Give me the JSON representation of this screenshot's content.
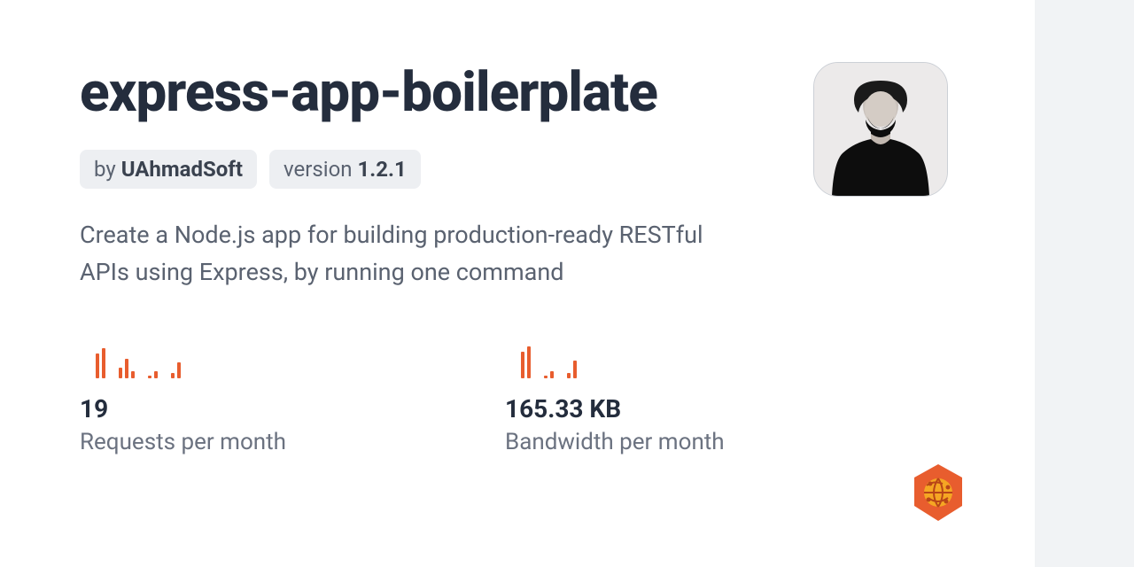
{
  "package": {
    "name": "express-app-boilerplate",
    "author_prefix": "by",
    "author": "UAhmadSoft",
    "version_prefix": "version",
    "version": "1.2.1",
    "description": "Create a Node.js app for building production-ready RESTful APIs using Express, by running one command"
  },
  "stats": {
    "requests": {
      "value": "19",
      "label": "Requests per month",
      "spark": [
        [
          28,
          34
        ],
        [
          12,
          22,
          8
        ],
        [
          3,
          8
        ],
        [
          6,
          18
        ]
      ]
    },
    "bandwidth": {
      "value": "165.33 KB",
      "label": "Bandwidth per month",
      "spark": [
        [
          30,
          36
        ],
        [
          3,
          8
        ],
        [
          6,
          20
        ]
      ]
    }
  },
  "colors": {
    "accent": "#e85d2e",
    "text_dark": "#242d3d",
    "text_muted": "#5a6270"
  }
}
